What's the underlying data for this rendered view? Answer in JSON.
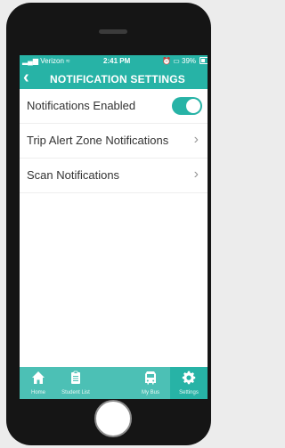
{
  "status_bar": {
    "carrier": "Verizon",
    "time": "2:41 PM",
    "battery_percent": "39%",
    "battery_level": 0.39
  },
  "header": {
    "title": "NOTIFICATION SETTINGS"
  },
  "settings": [
    {
      "label": "Notifications Enabled",
      "type": "toggle",
      "enabled": true
    },
    {
      "label": "Trip Alert Zone Notifications",
      "type": "link"
    },
    {
      "label": "Scan Notifications",
      "type": "link"
    }
  ],
  "tabs": [
    {
      "label": "Home",
      "icon": "home-icon",
      "active": false
    },
    {
      "label": "Student List",
      "icon": "clipboard-icon",
      "active": false
    },
    {
      "label": "My Bus",
      "icon": "bus-icon",
      "active": false
    },
    {
      "label": "Settings",
      "icon": "gear-icon",
      "active": true
    }
  ],
  "colors": {
    "accent": "#27b3a6",
    "tab_bar": "#4cc0b5"
  }
}
